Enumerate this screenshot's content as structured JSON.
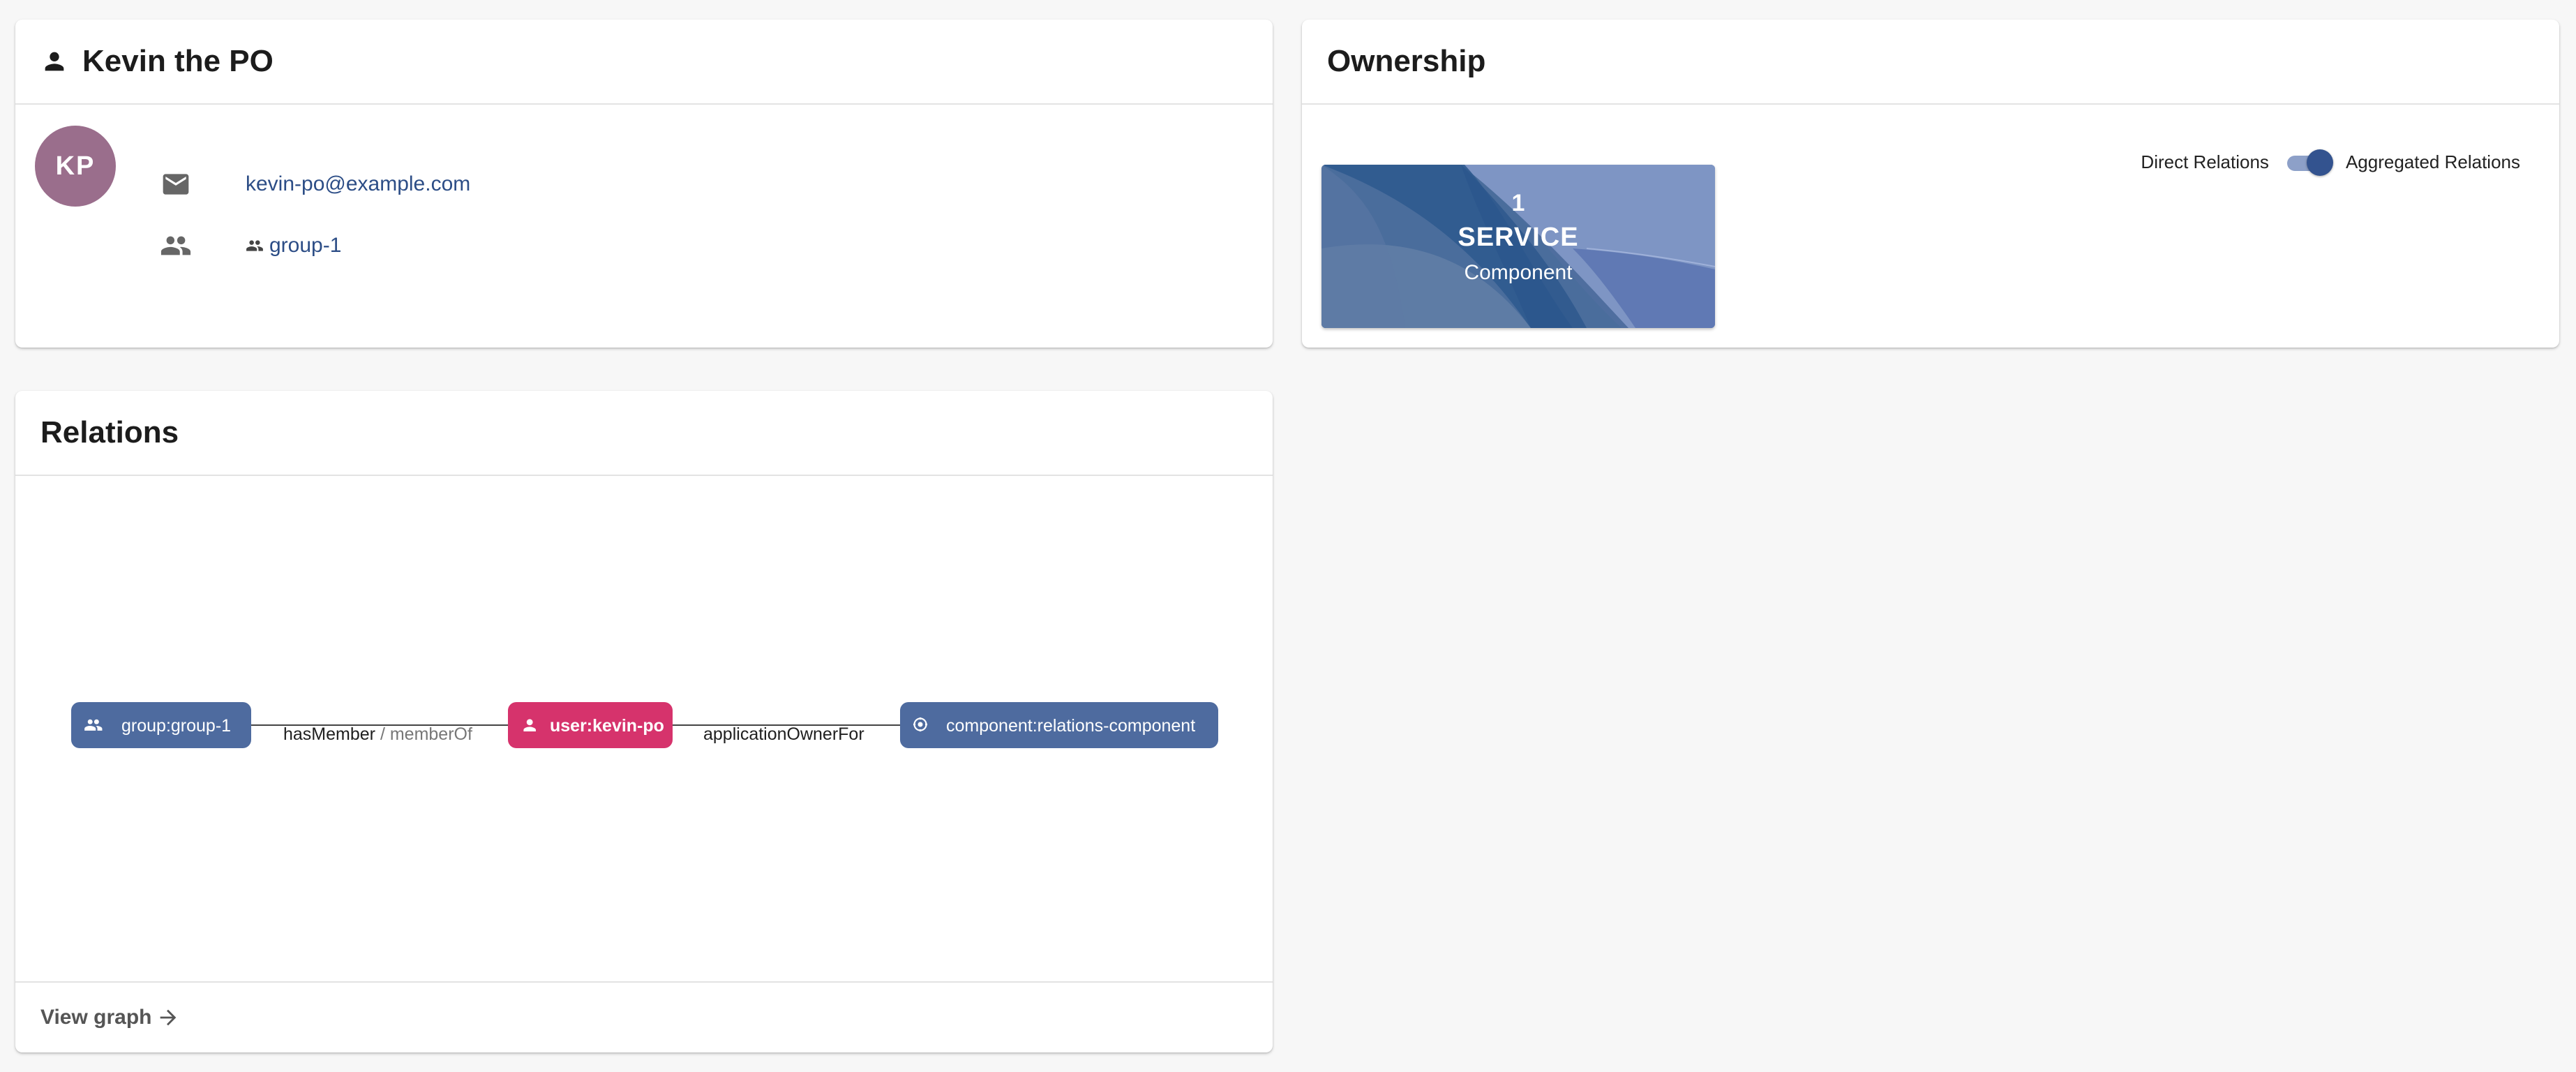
{
  "profile": {
    "title": "Kevin the PO",
    "avatar_initials": "KP",
    "email": "kevin-po@example.com",
    "group": "group-1"
  },
  "ownership": {
    "title": "Ownership",
    "toggle_left_label": "Direct Relations",
    "toggle_right_label": "Aggregated Relations",
    "toggle_state": "aggregated",
    "tile": {
      "count": "1",
      "type": "SERVICE",
      "kind": "Component"
    }
  },
  "relations": {
    "title": "Relations",
    "nodes": {
      "group": "group:group-1",
      "user": "user:kevin-po",
      "component": "component:relations-component"
    },
    "edges": {
      "left_label_primary": "hasMember",
      "left_label_sep": " / ",
      "left_label_secondary": "memberOf",
      "right_label": "applicationOwnerFor"
    },
    "view_graph_label": "View graph"
  },
  "colors": {
    "node_default": "#4e6b9f",
    "node_focus": "#d6336c",
    "link": "#2c4d86",
    "avatar": "#9a6e8c",
    "tile_base": "#5a78a8"
  }
}
